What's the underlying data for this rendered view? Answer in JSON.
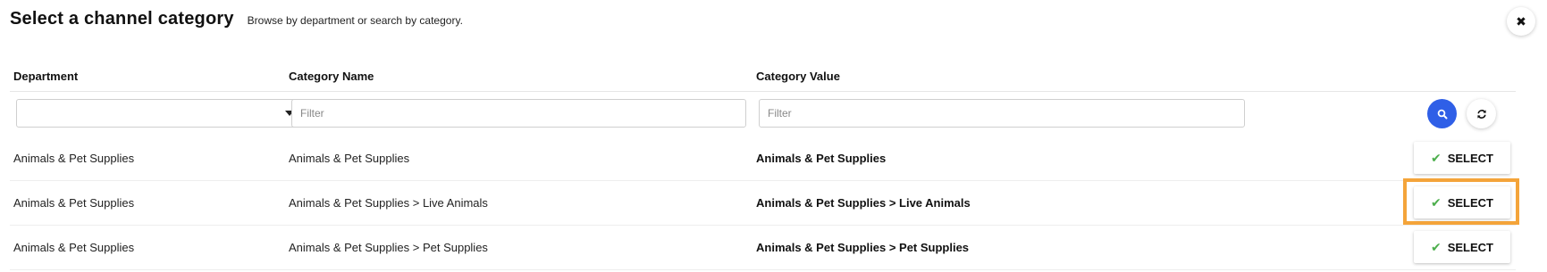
{
  "header": {
    "title": "Select a channel category",
    "subtitle": "Browse by department or search by category."
  },
  "close_icon": "close-icon",
  "columns": {
    "department": "Department",
    "category_name": "Category Name",
    "category_value": "Category Value"
  },
  "filters": {
    "department_value": "",
    "category_name_placeholder": "Filter",
    "category_value_placeholder": "Filter"
  },
  "actions": {
    "search_icon": "search-icon",
    "refresh_icon": "refresh-icon",
    "search_color": "#2f5fe7"
  },
  "rows": [
    {
      "department": "Animals & Pet Supplies",
      "category_name": "Animals & Pet Supplies",
      "category_value": "Animals & Pet Supplies",
      "select_label": "SELECT"
    },
    {
      "department": "Animals & Pet Supplies",
      "category_name": "Animals & Pet Supplies > Live Animals",
      "category_value": "Animals & Pet Supplies > Live Animals",
      "select_label": "SELECT",
      "highlighted": true
    },
    {
      "department": "Animals & Pet Supplies",
      "category_name": "Animals & Pet Supplies > Pet Supplies",
      "category_value": "Animals & Pet Supplies > Pet Supplies",
      "select_label": "SELECT"
    }
  ],
  "highlight_color": "#f4a43a"
}
